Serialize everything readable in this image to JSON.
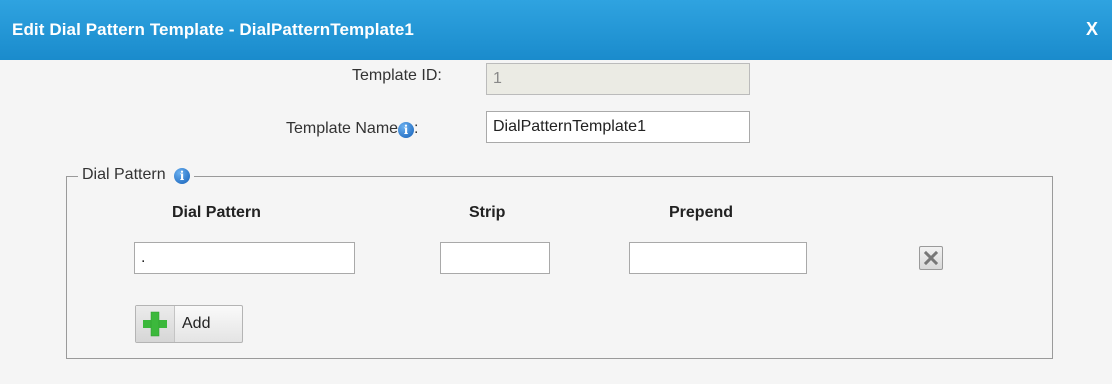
{
  "dialog": {
    "title": "Edit Dial Pattern Template - DialPatternTemplate1",
    "close_label": "X"
  },
  "form": {
    "template_id_label": "Template ID:",
    "template_id_value": "1",
    "template_name_label": "Template Name",
    "template_name_colon": ":",
    "template_name_value": "DialPatternTemplate1"
  },
  "dial_pattern_section": {
    "legend": "Dial Pattern",
    "columns": {
      "dial_pattern": "Dial Pattern",
      "strip": "Strip",
      "prepend": "Prepend"
    },
    "rows": [
      {
        "dial_pattern": ".",
        "strip": "",
        "prepend": ""
      }
    ],
    "add_label": "Add"
  },
  "colors": {
    "title_bar": "#1a8bcc",
    "info_icon": "#1560b8",
    "add_icon": "#3cb83c"
  },
  "icons": {
    "info": "info-icon",
    "delete": "delete-x-icon",
    "add": "plus-icon"
  }
}
